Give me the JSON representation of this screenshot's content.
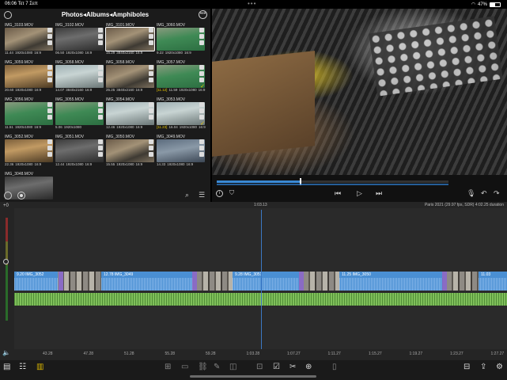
{
  "status": {
    "time": "06:06",
    "date": "Τετ 7 Σεπ",
    "battery": "47%",
    "battery_level": 0.47
  },
  "browser": {
    "title": "Photos◂Albums◂Amphiboles",
    "clips": [
      {
        "name": "IMG_3103.MOV",
        "duration": "11.44",
        "resolution": "1920x1080",
        "aspect": "16:9",
        "thumb": "factory",
        "selected": false,
        "yellow": false
      },
      {
        "name": "IMG_3102.MOV",
        "duration": "06.50",
        "resolution": "1920x1080",
        "aspect": "16:9",
        "thumb": "dark",
        "selected": false,
        "yellow": false
      },
      {
        "name": "IMG_3101.MOV",
        "duration": "15.29",
        "resolution": "3840x2160",
        "aspect": "16:9",
        "thumb": "factory",
        "selected": true,
        "yellow": false
      },
      {
        "name": "IMG_3060.MOV",
        "duration": "9.22",
        "resolution": "1920x1080",
        "aspect": "16:9",
        "thumb": "green",
        "selected": false,
        "yellow": false
      },
      {
        "name": "IMG_3059.MOV",
        "duration": "20.60",
        "resolution": "1920x1080",
        "aspect": "16:9",
        "thumb": "warm",
        "selected": false,
        "yellow": false
      },
      {
        "name": "IMG_3058.MOV",
        "duration": "14.07",
        "resolution": "3840x2160",
        "aspect": "16:9",
        "thumb": "lab",
        "selected": false,
        "yellow": false
      },
      {
        "name": "IMG_3058.MOV",
        "duration": "25.25",
        "resolution": "3840x2160",
        "aspect": "16:9",
        "thumb": "factory",
        "selected": false,
        "yellow": false
      },
      {
        "name": "IMG_3057.MOV",
        "duration": "[11.12]",
        "extra": "11.59",
        "resolution": "1920x1080",
        "aspect": "16:9",
        "thumb": "green",
        "selected": false,
        "yellow": true
      },
      {
        "name": "IMG_3056.MOV",
        "duration": "11.51",
        "resolution": "1920x1080",
        "aspect": "16:9",
        "thumb": "green",
        "selected": false,
        "yellow": false
      },
      {
        "name": "IMG_3055.MOV",
        "duration": "5.06",
        "resolution": "1920x1080",
        "aspect": "",
        "thumb": "green",
        "selected": false,
        "yellow": false
      },
      {
        "name": "IMG_3054.MOV",
        "duration": "12.46",
        "resolution": "1920x1080",
        "aspect": "16:9",
        "thumb": "lab",
        "selected": false,
        "yellow": false
      },
      {
        "name": "IMG_3053.MOV",
        "duration": "[11.23]",
        "extra": "16.04",
        "resolution": "1920x1080",
        "aspect": "16:9",
        "thumb": "lab",
        "selected": false,
        "yellow": true
      },
      {
        "name": "IMG_3052.MOV",
        "duration": "22.36",
        "resolution": "1920x1080",
        "aspect": "16:9",
        "thumb": "warm",
        "selected": false,
        "yellow": false
      },
      {
        "name": "IMG_3051.MOV",
        "duration": "12.44",
        "resolution": "1920x1080",
        "aspect": "16:9",
        "thumb": "dark",
        "selected": false,
        "yellow": false
      },
      {
        "name": "IMG_3050.MOV",
        "duration": "15.55",
        "resolution": "1920x1080",
        "aspect": "16:9",
        "thumb": "factory",
        "selected": false,
        "yellow": false
      },
      {
        "name": "IMG_3049.MOV",
        "duration": "14.33",
        "resolution": "1920x1080",
        "aspect": "16:9",
        "thumb": "blue",
        "selected": false,
        "yellow": false
      },
      {
        "name": "IMG_3048.MOV",
        "duration": "",
        "resolution": "",
        "aspect": "",
        "thumb": "dark",
        "selected": false,
        "yellow": false
      }
    ]
  },
  "scrubber": {
    "progress": 0.36
  },
  "timeline": {
    "playhead_time": "1:03.13",
    "project_info": "Paris 2021 (29.97 fps, SDR) 4:02.25 duration",
    "meter_label": "+0",
    "segments": [
      {
        "label": "9.20 IMG_3052"
      },
      {
        "label": "12.78 IMG_3049"
      },
      {
        "label": "9.28 IMG_3051"
      },
      {
        "label": "11.25 IMG_3050"
      },
      {
        "label": "11.03"
      }
    ],
    "ruler": [
      "43.28",
      "47.28",
      "51.28",
      "55.28",
      "59.28",
      "1:03.28",
      "1:07.27",
      "1:11.27",
      "1:15.27",
      "1:19.27",
      "1:23.27",
      "1:27.27"
    ]
  },
  "icons": {
    "settings": "gear-icon",
    "more": "ellipsis-icon",
    "select": "check-circle-icon",
    "record": "record-icon",
    "search": "search-icon",
    "sort": "sort-icon",
    "info": "info-icon",
    "shield": "shield-icon",
    "prev": "skip-back-icon",
    "play": "play-icon",
    "next": "skip-forward-icon",
    "voiceover": "voiceover-icon",
    "undo": "undo-icon",
    "redo": "redo-icon",
    "speaker": "speaker-icon"
  },
  "colors": {
    "accent": "#4a8fd3",
    "audio": "#7fbf5a",
    "transition": "#8a6bc4",
    "highlight": "#e5c300"
  }
}
